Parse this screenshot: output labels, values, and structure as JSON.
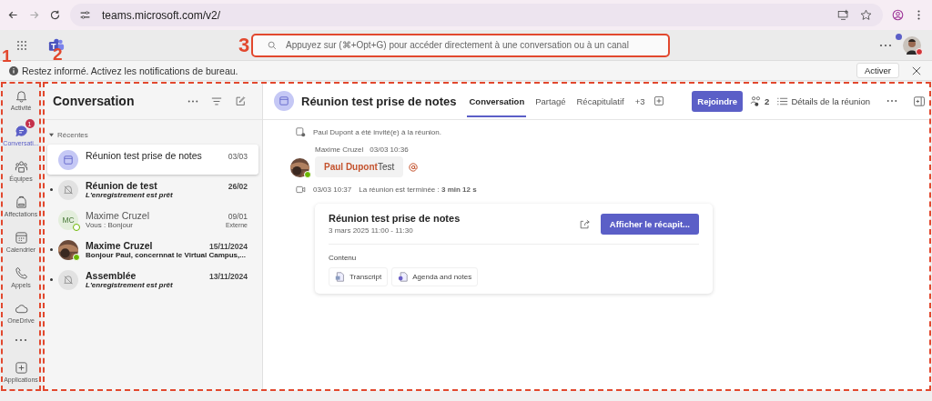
{
  "browser": {
    "url": "teams.microsoft.com/v2/"
  },
  "header": {
    "search": {
      "placeholder": "Appuyez sur (⌘+Opt+G) pour accéder directement à une conversation ou à un canal"
    }
  },
  "notification": {
    "text": "Restez informé. Activez les notifications de bureau.",
    "button": "Activer"
  },
  "rail": {
    "items": [
      {
        "label": "Activité",
        "selected": false
      },
      {
        "label": "Conversati...",
        "selected": true,
        "badge": "1"
      },
      {
        "label": "Équipes",
        "selected": false
      },
      {
        "label": "Affectations",
        "selected": false
      },
      {
        "label": "Calendrier",
        "selected": false
      },
      {
        "label": "Appels",
        "selected": false
      },
      {
        "label": "OneDrive",
        "selected": false
      }
    ],
    "apps": "Applications"
  },
  "conversations": {
    "title": "Conversation",
    "section": {
      "label": "Récentes",
      "expanded": true
    },
    "items": [
      {
        "kind": "meeting",
        "title": "Réunion test prise de notes",
        "date": "03/03",
        "unread": false,
        "selected": true
      },
      {
        "kind": "muted",
        "title": "Réunion de test",
        "date": "26/02",
        "preview": "L'enregistrement est prêt",
        "unread": true,
        "selected": false
      },
      {
        "kind": "initials",
        "initials": "MC",
        "title": "Maxime Cruzel",
        "date": "09/01",
        "preview": "Vous : Bonjour",
        "tag": "Externe",
        "unread": false,
        "selected": false
      },
      {
        "title": "Maxime Cruzel",
        "date": "15/11/2024",
        "preview": "Bonjour Paul, concernnat le Virtual Campus,...",
        "unread": true,
        "selected": false
      },
      {
        "kind": "muted",
        "title": "Assemblée",
        "date": "13/11/2024",
        "preview": "L'enregistrement est prêt",
        "unread": true,
        "selected": false
      }
    ]
  },
  "chat": {
    "title": "Réunion test prise de notes",
    "tabs": [
      {
        "label": "Conversation",
        "selected": true
      },
      {
        "label": "Partagé",
        "selected": false
      },
      {
        "label": "Récapitulatif",
        "selected": false
      }
    ],
    "more_tabs": "+3",
    "join": "Rejoindre",
    "participants": "2",
    "details": "Détails de la réunion",
    "system": "Paul Dupont a été invité(e) à la réunion.",
    "message": {
      "author": "Maxime Cruzel",
      "time": "03/03 10:36",
      "mention": "Paul Dupont",
      "text": "Test"
    },
    "event": {
      "time": "03/03 10:37",
      "text": "La réunion est terminée : **3 min 12 s**"
    },
    "card": {
      "title": "Réunion test prise de notes",
      "date": "3 mars 2025 11:00 - 11:30",
      "button": "Afficher le récapit...",
      "section": "Contenu",
      "files": [
        "Transcript",
        "Agenda and notes"
      ]
    }
  },
  "annotations": [
    {
      "label": "1"
    },
    {
      "label": "2"
    },
    {
      "label": "3"
    }
  ]
}
